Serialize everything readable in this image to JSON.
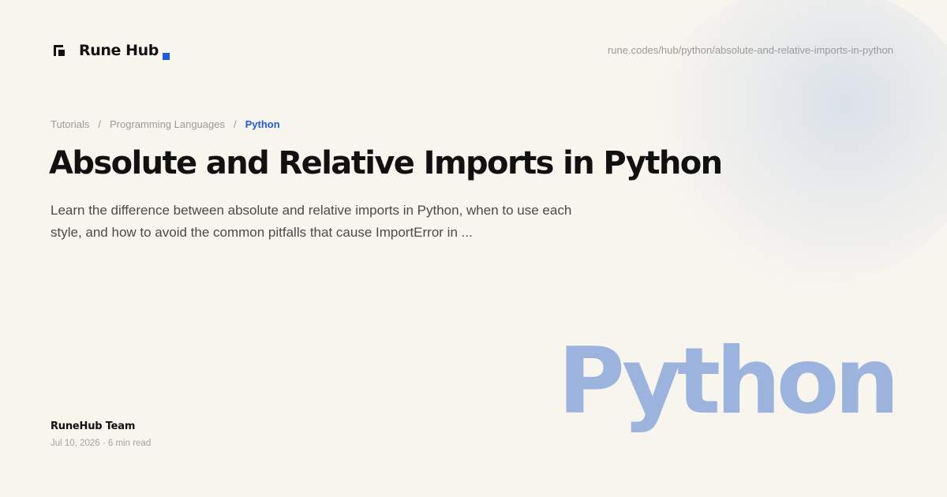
{
  "brand": {
    "name": "Rune Hub",
    "accent_color": "#1f5bd8",
    "logo_icon": "bracket-square-logo-icon"
  },
  "page_url": "rune.codes/hub/python/absolute-and-relative-imports-in-python",
  "breadcrumb": {
    "items": [
      "Tutorials",
      "Programming Languages"
    ],
    "separator": "/",
    "current": "Python"
  },
  "article": {
    "title": "Absolute and Relative Imports in Python",
    "summary": "Learn the difference between absolute and relative imports in Python, when to use each style, and how to avoid the common pitfalls that cause ImportError in ...",
    "author": "RuneHub Team",
    "meta": "Jul 10, 2026 · 6 min read"
  },
  "topic_word": "Python",
  "colors": {
    "background": "#f8f5ef",
    "title": "#111111",
    "topic_word": "#9cb3dd",
    "breadcrumb_current": "#1f5bd8"
  }
}
